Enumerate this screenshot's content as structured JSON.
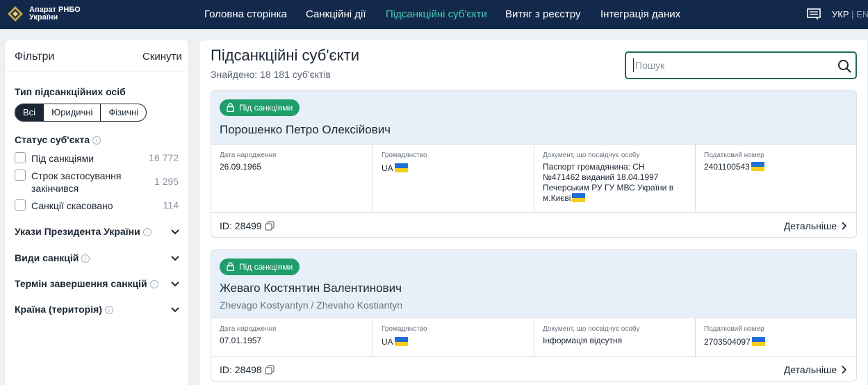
{
  "header": {
    "brand_line1": "Апарат РНБО",
    "brand_line2": "України",
    "nav": [
      "Головна сторінка",
      "Санкційні дії",
      "Підсанкційні суб'єкти",
      "Витяг з реєстру",
      "Інтеграція даних"
    ],
    "active_nav": "Підсанкційні суб'єкти",
    "lang_active": "УКР",
    "lang_separator": "|",
    "lang_other": "ENG",
    "accent_color": "#3fd0b5",
    "bg_color": "#13294b"
  },
  "sidebar": {
    "title": "Фільтри",
    "reset": "Скинути",
    "type_title": "Тип підсанкційних осіб",
    "type_options": [
      "Всі",
      "Юридичні",
      "Фізичні"
    ],
    "type_selected": "Всі",
    "status_title": "Статус суб'єкта",
    "status_items": [
      {
        "label": "Під санкціями",
        "count": "16 772"
      },
      {
        "label": "Строк застосування закінчився",
        "count": "1 295"
      },
      {
        "label": "Санкції скасовано",
        "count": "114"
      }
    ],
    "accordions": [
      {
        "label": "Укази Президента України",
        "info": true
      },
      {
        "label": "Види санкцій",
        "info": true
      },
      {
        "label": "Термін завершення санкцій",
        "info": true
      },
      {
        "label": "Країна (територія)",
        "info": true
      }
    ]
  },
  "main": {
    "title": "Підсанкційні суб'єкти",
    "found": "Знайдено: 18 181 суб'єктів",
    "search_placeholder": "Пошук",
    "badge_color": "#1f9d6a",
    "cards": [
      {
        "badge": "Під санкціями",
        "name": "Порошенко Петро Олексійович",
        "alt_name": "",
        "birth_label": "Дата народження",
        "birth": "26.09.1965",
        "citizenship_label": "Громадянство",
        "citizenship": "UA",
        "doc_label": "Документ, що посвідчує особу",
        "doc": "Паспорт громадянина: СН №471462 виданий 18.04.1997 Печерським РУ ГУ МВС України в м.Києві",
        "tax_label": "Податковий номер",
        "tax": "2401100543",
        "id": "ID: 28499",
        "details": "Детальніше"
      },
      {
        "badge": "Під санкціями",
        "name": "Жеваго Костянтин Валентинович",
        "alt_name": "Zhevago Kostyantyn / Zhevaho Kostiantyn",
        "birth_label": "Дата народження",
        "birth": "07.01.1957",
        "citizenship_label": "Громадянство",
        "citizenship": "UA",
        "doc_label": "Документ, що посвідчує особу",
        "doc": "Інформація відсутня",
        "tax_label": "Податковий номер",
        "tax": "2703504097",
        "id": "ID: 28498",
        "details": "Детальніше"
      }
    ]
  }
}
